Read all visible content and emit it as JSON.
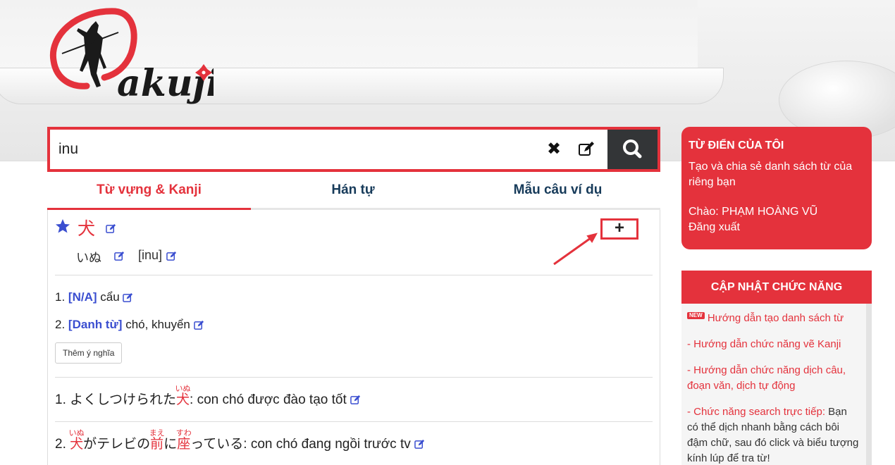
{
  "brand": {
    "logo_text": "akuji"
  },
  "search": {
    "value": "inu",
    "clear_icon": "✖"
  },
  "tabs": [
    {
      "label": "Từ vựng & Kanji",
      "active": true
    },
    {
      "label": "Hán tự",
      "active": false
    },
    {
      "label": "Mẫu câu ví dụ",
      "active": false
    }
  ],
  "entry": {
    "word": "犬",
    "reading_kana": "いぬ",
    "reading_romaji": "[inu]",
    "add_button_label": "+",
    "meanings": [
      {
        "num": "1.",
        "tag": "[N/A]",
        "text": "cẩu"
      },
      {
        "num": "2.",
        "tag": "[Danh từ]",
        "text": "chó, khuyển"
      }
    ],
    "add_meaning_label": "Thêm ý nghĩa",
    "examples": [
      {
        "num": "1.",
        "pre": "よくしつけられた",
        "kanji": "犬",
        "furigana": "いぬ",
        "post": ": con chó được đào tạo tốt"
      },
      {
        "num": "2.",
        "k1": "犬",
        "f1": "いぬ",
        "s1": "がテレビの",
        "k2": "前",
        "f2": "まえ",
        "s2": "に",
        "k3": "座",
        "f3": "すわ",
        "s3": "っている: con chó đang ngồi trước tv"
      }
    ]
  },
  "sidebar": {
    "mydict": {
      "title": "TỪ ĐIỂN CỦA TÔI",
      "description": "Tạo và chia sẻ danh sách từ của riêng bạn",
      "greeting": "Chào: PHẠM HOÀNG VŨ",
      "logout": "Đăng xuất"
    },
    "updates": {
      "title": "CẬP NHẬT CHỨC NĂNG",
      "new_badge": "NEW",
      "items": [
        {
          "text": "Hướng dẫn tạo danh sách từ"
        },
        {
          "text": "- Hướng dẫn chức năng vẽ Kanji"
        },
        {
          "text": "- Hướng dẫn chức năng dịch câu, đoạn văn, dịch tự động"
        },
        {
          "text": "- Chức năng search trực tiếp:",
          "plain": " Bạn có thể dịch nhanh bằng cách bôi đậm chữ, sau đó click và biểu tượng kính lúp để tra từ!"
        }
      ]
    }
  },
  "colors": {
    "accent": "#e4323c",
    "tab_text": "#173b5a",
    "tag_blue": "#3a4ed0",
    "search_btn": "#333537"
  }
}
